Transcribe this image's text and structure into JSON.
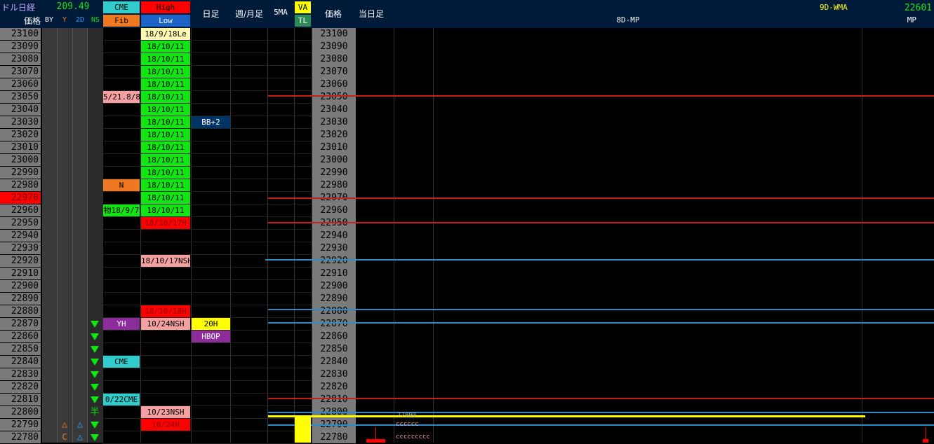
{
  "header": {
    "title": "ドル日経",
    "usdjpy": "209.49",
    "price_label": "価格",
    "sub_by": "BY",
    "sub_y": "Y",
    "sub_2d": "2D",
    "sub_ns": "NS",
    "cme": "CME",
    "fib": "Fib",
    "high": "High",
    "low": "Low",
    "daily": "日足",
    "weekly": "週/月足",
    "ma5": "5MA",
    "va": "VA",
    "tl": "TL",
    "price_label2": "価格",
    "today": "当日足",
    "mp8d": "8D-MP",
    "wma9d": "9D-WMA",
    "mp_value": "22601",
    "mp": "MP"
  },
  "prices": [
    "23100",
    "23090",
    "23080",
    "23070",
    "23060",
    "23050",
    "23040",
    "23030",
    "23020",
    "23010",
    "23000",
    "22990",
    "22980",
    "22970",
    "22960",
    "22950",
    "22940",
    "22930",
    "22920",
    "22910",
    "22900",
    "22890",
    "22880",
    "22870",
    "22860",
    "22850",
    "22840",
    "22830",
    "22820",
    "22810",
    "22800",
    "22790",
    "22780"
  ],
  "highlight_price": "22970",
  "markers": {
    "row30_ns": "半",
    "row31_y": "△",
    "row31_2d": "△",
    "row32_y": "C",
    "row32_2d": "△"
  },
  "fib_cells": {
    "r5": "5/21.8/8",
    "r12": "N",
    "r14": "物18/9/7",
    "r23": "YH",
    "r26": "CME",
    "r29": "0/22CME"
  },
  "highlow_cells": {
    "r0": "18/9/18Le",
    "r1": "18/10/11",
    "r2": "18/10/11",
    "r3": "18/10/11",
    "r4": "18/10/11",
    "r5": "18/10/11",
    "r6": "18/10/11",
    "r7": "18/10/11",
    "r8": "18/10/11",
    "r9": "18/10/11",
    "r10": "18/10/11",
    "r11": "18/10/11",
    "r12": "18/10/11",
    "r13": "18/10/11",
    "r14": "18/10/11",
    "r15": "18/10/17H",
    "r18": "18/10/17NSH",
    "r22": "18/10/18H",
    "r23": "10/24NSH",
    "r30": "10/23NSH",
    "r31": "10/24H"
  },
  "daily_cells": {
    "r7": "BB+2",
    "r23": "20H",
    "r24": "HBOP"
  },
  "profile": {
    "r30": "77800",
    "r31": "cccccc",
    "r32": "ccccccccc"
  },
  "colors": {
    "header_bg": "#001a3a",
    "price_bg": "#7a7a7a",
    "green": "#12e612",
    "red": "#ff0000",
    "pink": "#f4a0a0",
    "teal": "#3cc",
    "orange": "#f07820",
    "purple": "#8b2c9a",
    "navy": "#003366",
    "yellow": "#ffff00",
    "redline": "#c81e1e",
    "blueline": "#2c8cc8"
  }
}
